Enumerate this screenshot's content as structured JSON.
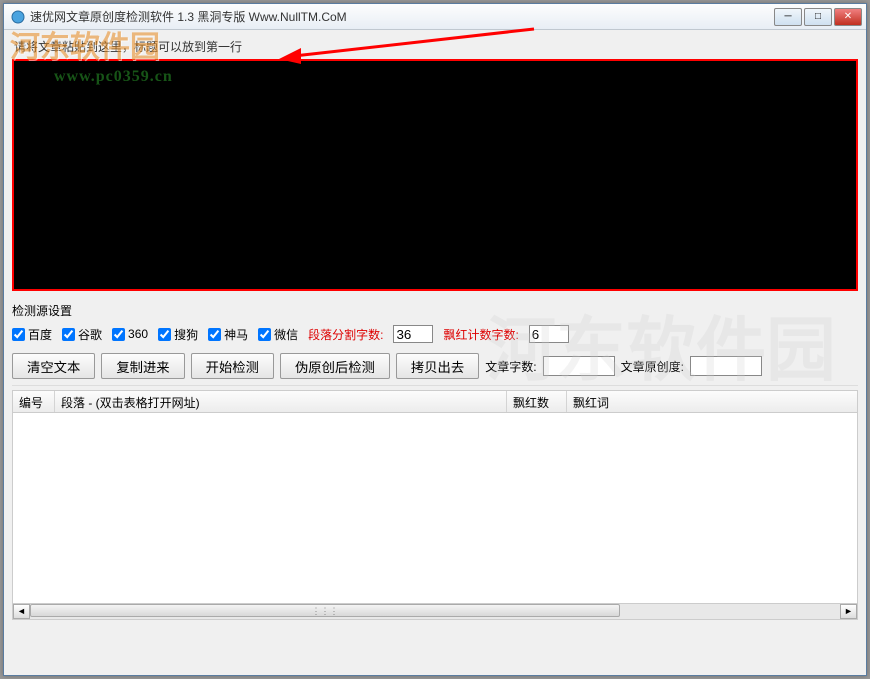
{
  "window": {
    "title": "速优网文章原创度检测软件 1.3   黑洞专版 Www.NullTM.CoM"
  },
  "editor": {
    "hint": "请将文章粘贴到这里，标题可以放到第一行"
  },
  "sources": {
    "label": "检测源设置",
    "items": [
      {
        "label": "百度",
        "checked": true
      },
      {
        "label": "谷歌",
        "checked": true
      },
      {
        "label": "360",
        "checked": true
      },
      {
        "label": "搜狗",
        "checked": true
      },
      {
        "label": "神马",
        "checked": true
      },
      {
        "label": "微信",
        "checked": true
      }
    ],
    "seg_label": "段落分割字数:",
    "seg_value": "36",
    "red_label": "飘红计数字数:",
    "red_value": "6"
  },
  "buttons": {
    "clear": "清空文本",
    "paste": "复制进来",
    "start": "开始检测",
    "pseudocheck": "伪原创后检测",
    "copyout": "拷贝出去"
  },
  "stats": {
    "wc_label": "文章字数:",
    "wc_value": "",
    "orig_label": "文章原创度:",
    "orig_value": ""
  },
  "table": {
    "c1": "编号",
    "c2": "段落 - (双击表格打开网址)",
    "c3": "飘红数",
    "c4": "飘红词"
  },
  "watermark": {
    "name": "河东软件园",
    "url": "www.pc0359.cn"
  }
}
